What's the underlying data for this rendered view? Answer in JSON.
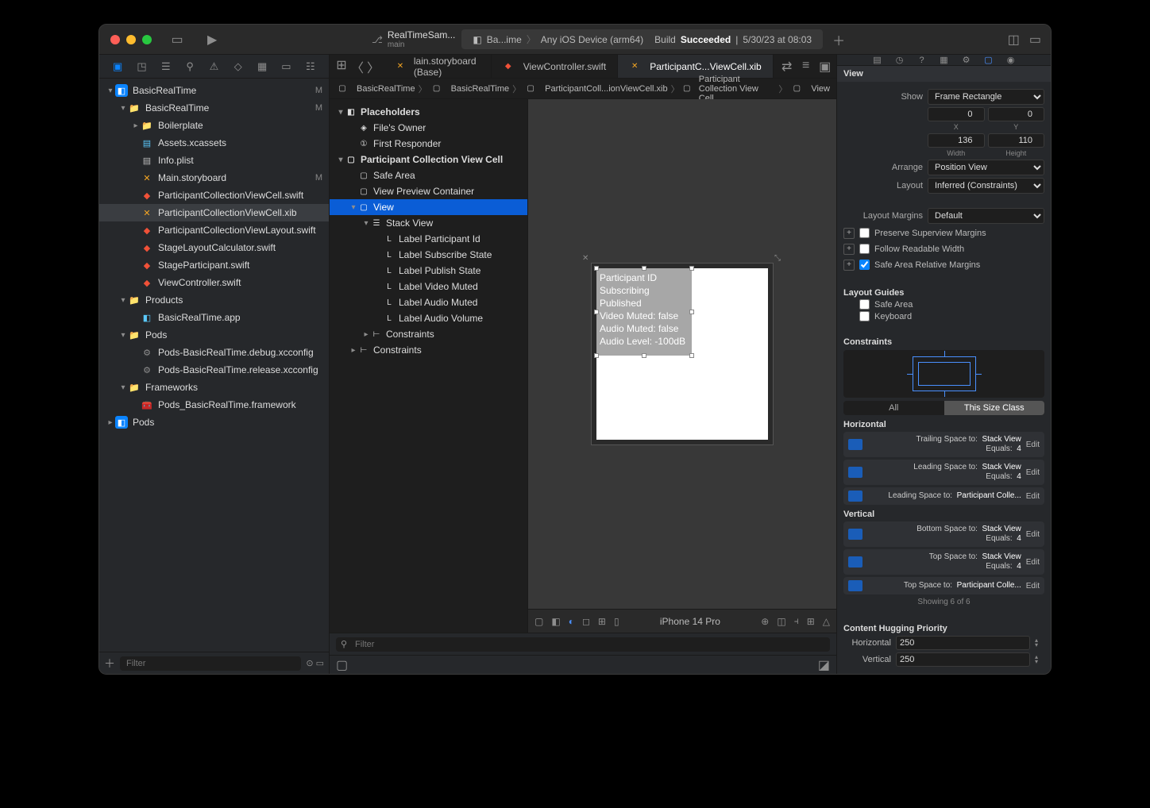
{
  "titlebar": {
    "project_name": "RealTimeSam...",
    "branch": "main",
    "scheme_app": "Ba...ime",
    "scheme_device": "Any iOS Device (arm64)",
    "status_prefix": "Build",
    "status_result": "Succeeded",
    "status_time": "5/30/23 at 08:03"
  },
  "nav": {
    "filter_placeholder": "Filter",
    "tree": [
      {
        "indent": 0,
        "icon": "proj",
        "label": "BasicRealTime",
        "disc": "▾",
        "mod": "M"
      },
      {
        "indent": 1,
        "icon": "folder",
        "label": "BasicRealTime",
        "disc": "▾",
        "mod": "M"
      },
      {
        "indent": 2,
        "icon": "folder",
        "label": "Boilerplate",
        "disc": "▸"
      },
      {
        "indent": 2,
        "icon": "assets",
        "label": "Assets.xcassets"
      },
      {
        "indent": 2,
        "icon": "plist",
        "label": "Info.plist"
      },
      {
        "indent": 2,
        "icon": "sb",
        "label": "Main.storyboard",
        "mod": "M"
      },
      {
        "indent": 2,
        "icon": "swift",
        "label": "ParticipantCollectionViewCell.swift"
      },
      {
        "indent": 2,
        "icon": "xib",
        "label": "ParticipantCollectionViewCell.xib",
        "sel": true
      },
      {
        "indent": 2,
        "icon": "swift",
        "label": "ParticipantCollectionViewLayout.swift"
      },
      {
        "indent": 2,
        "icon": "swift",
        "label": "StageLayoutCalculator.swift"
      },
      {
        "indent": 2,
        "icon": "swift",
        "label": "StageParticipant.swift"
      },
      {
        "indent": 2,
        "icon": "swift",
        "label": "ViewController.swift"
      },
      {
        "indent": 1,
        "icon": "folder",
        "label": "Products",
        "disc": "▾"
      },
      {
        "indent": 2,
        "icon": "app",
        "label": "BasicRealTime.app"
      },
      {
        "indent": 1,
        "icon": "folder",
        "label": "Pods",
        "disc": "▾"
      },
      {
        "indent": 2,
        "icon": "config",
        "label": "Pods-BasicRealTime.debug.xcconfig"
      },
      {
        "indent": 2,
        "icon": "config",
        "label": "Pods-BasicRealTime.release.xcconfig"
      },
      {
        "indent": 1,
        "icon": "folder",
        "label": "Frameworks",
        "disc": "▾"
      },
      {
        "indent": 2,
        "icon": "fw",
        "label": "Pods_BasicRealTime.framework"
      },
      {
        "indent": 0,
        "icon": "proj",
        "label": "Pods",
        "disc": "▸"
      }
    ]
  },
  "tabs": [
    {
      "icon": "sb",
      "label": "lain.storyboard (Base)"
    },
    {
      "icon": "swift",
      "label": "ViewController.swift"
    },
    {
      "icon": "xib",
      "label": "ParticipantC...ViewCell.xib",
      "active": true
    }
  ],
  "jumpbar": [
    "BasicRealTime",
    "BasicRealTime",
    "ParticipantColl...ionViewCell.xib",
    "Participant Collection View Cell",
    "View"
  ],
  "outline": [
    {
      "indent": 0,
      "icon": "ph",
      "label": "Placeholders",
      "disc": "▾",
      "bold": true
    },
    {
      "indent": 1,
      "icon": "owner",
      "label": "File's Owner"
    },
    {
      "indent": 1,
      "icon": "resp",
      "label": "First Responder"
    },
    {
      "indent": 0,
      "icon": "cell",
      "label": "Participant Collection View Cell",
      "disc": "▾",
      "bold": true
    },
    {
      "indent": 1,
      "icon": "safe",
      "label": "Safe Area"
    },
    {
      "indent": 1,
      "icon": "view",
      "label": "View Preview Container"
    },
    {
      "indent": 1,
      "icon": "view",
      "label": "View",
      "disc": "▾",
      "sel": true
    },
    {
      "indent": 2,
      "icon": "stack",
      "label": "Stack View",
      "disc": "▾"
    },
    {
      "indent": 3,
      "icon": "lbl",
      "label": "Label Participant Id"
    },
    {
      "indent": 3,
      "icon": "lbl",
      "label": "Label Subscribe State"
    },
    {
      "indent": 3,
      "icon": "lbl",
      "label": "Label Publish State"
    },
    {
      "indent": 3,
      "icon": "lbl",
      "label": "Label Video Muted"
    },
    {
      "indent": 3,
      "icon": "lbl",
      "label": "Label Audio Muted"
    },
    {
      "indent": 3,
      "icon": "lbl",
      "label": "Label Audio Volume"
    },
    {
      "indent": 2,
      "icon": "con",
      "label": "Constraints",
      "disc": "▸"
    },
    {
      "indent": 1,
      "icon": "con",
      "label": "Constraints",
      "disc": "▸"
    }
  ],
  "outline_filter_placeholder": "Filter",
  "canvas": {
    "labels": [
      "Participant ID",
      "Subscribing",
      "Published",
      "Video Muted: false",
      "Audio Muted: false",
      "Audio Level: -100dB"
    ],
    "device": "iPhone 14 Pro"
  },
  "inspector": {
    "header": "View",
    "show_label": "Show",
    "show_value": "Frame Rectangle",
    "x": "0",
    "y": "0",
    "x_lbl": "X",
    "y_lbl": "Y",
    "width": "136",
    "height": "110",
    "w_lbl": "Width",
    "h_lbl": "Height",
    "arrange_label": "Arrange",
    "arrange_value": "Position View",
    "layout_label": "Layout",
    "layout_value": "Inferred (Constraints)",
    "margins_label": "Layout Margins",
    "margins_value": "Default",
    "chk_preserve": "Preserve Superview Margins",
    "chk_readable": "Follow Readable Width",
    "chk_safearea": "Safe Area Relative Margins",
    "guides_header": "Layout Guides",
    "chk_safe_guide": "Safe Area",
    "chk_keyboard": "Keyboard",
    "constraints_header": "Constraints",
    "seg_all": "All",
    "seg_this": "This Size Class",
    "horizontal_header": "Horizontal",
    "vertical_header": "Vertical",
    "h_constraints": [
      {
        "l1": "Trailing Space to:",
        "v1": "Stack View",
        "l2": "Equals:",
        "v2": "4"
      },
      {
        "l1": "Leading Space to:",
        "v1": "Stack View",
        "l2": "Equals:",
        "v2": "4"
      },
      {
        "l1": "Leading Space to:",
        "v1": "Participant Colle..."
      }
    ],
    "v_constraints": [
      {
        "l1": "Bottom Space to:",
        "v1": "Stack View",
        "l2": "Equals:",
        "v2": "4"
      },
      {
        "l1": "Top Space to:",
        "v1": "Stack View",
        "l2": "Equals:",
        "v2": "4"
      },
      {
        "l1": "Top Space to:",
        "v1": "Participant Colle..."
      }
    ],
    "edit_label": "Edit",
    "showing": "Showing 6 of 6",
    "hugging_header": "Content Hugging Priority",
    "hug_h_label": "Horizontal",
    "hug_h": "250",
    "hug_v_label": "Vertical",
    "hug_v": "250"
  }
}
